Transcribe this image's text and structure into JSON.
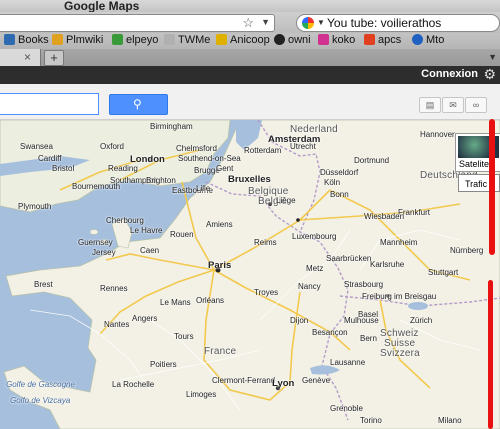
{
  "window": {
    "title": "Google Maps"
  },
  "address_bar": {
    "value": ""
  },
  "search_bar": {
    "value": "You tube: voilierathos"
  },
  "bookmarks": [
    {
      "label": "Books",
      "icon": "book-icon",
      "color": "#2e6ab0"
    },
    {
      "label": "Plmwiki",
      "icon": "wiki-icon",
      "color": "#e0a020"
    },
    {
      "label": "elpeyo",
      "icon": "leaf-icon",
      "color": "#3a9a3a"
    },
    {
      "label": "TWMe",
      "icon": "page-icon",
      "color": "#b0b0b0"
    },
    {
      "label": "Anicoop",
      "icon": "star-icon",
      "color": "#e0b000"
    },
    {
      "label": "owni",
      "icon": "circle-icon",
      "color": "#222222"
    },
    {
      "label": "koko",
      "icon": "flower-icon",
      "color": "#d03090"
    },
    {
      "label": "apcs",
      "icon": "flag-icon",
      "color": "#e04020"
    },
    {
      "label": "Mto",
      "icon": "globe-icon",
      "color": "#2060c0"
    }
  ],
  "tab": {
    "close": "×",
    "new": "+"
  },
  "google_bar": {
    "signin": "Connexion"
  },
  "map_controls": {
    "satellite": "Satelite",
    "traffic": "Trafic"
  },
  "map": {
    "cities": [
      {
        "name": "London",
        "type": "major"
      },
      {
        "name": "Birmingham",
        "type": "major"
      },
      {
        "name": "Cardiff",
        "type": ""
      },
      {
        "name": "Bristol",
        "type": ""
      },
      {
        "name": "Plymouth",
        "type": ""
      },
      {
        "name": "Southampton",
        "type": ""
      },
      {
        "name": "Brighton",
        "type": ""
      },
      {
        "name": "Swansea",
        "type": ""
      },
      {
        "name": "Chelmsford",
        "type": ""
      },
      {
        "name": "Southend-on-Sea",
        "type": ""
      },
      {
        "name": "Oxford",
        "type": ""
      },
      {
        "name": "Reading",
        "type": ""
      },
      {
        "name": "Eastbourne",
        "type": ""
      },
      {
        "name": "Bournemouth",
        "type": ""
      },
      {
        "name": "Guernsey",
        "type": ""
      },
      {
        "name": "Jersey",
        "type": ""
      },
      {
        "name": "Nederland",
        "type": "country"
      },
      {
        "name": "Amsterdam",
        "type": "major"
      },
      {
        "name": "Rotterdam",
        "type": ""
      },
      {
        "name": "Utrecht",
        "type": ""
      },
      {
        "name": "Hannover",
        "type": ""
      },
      {
        "name": "Dortmund",
        "type": ""
      },
      {
        "name": "Düsseldorf",
        "type": ""
      },
      {
        "name": "Köln",
        "type": ""
      },
      {
        "name": "Bonn",
        "type": ""
      },
      {
        "name": "Brugge",
        "type": ""
      },
      {
        "name": "Gent",
        "type": ""
      },
      {
        "name": "Bruxelles",
        "type": "major"
      },
      {
        "name": "Belgique",
        "type": "country"
      },
      {
        "name": "België",
        "type": "country"
      },
      {
        "name": "Lille",
        "type": ""
      },
      {
        "name": "Liège",
        "type": ""
      },
      {
        "name": "Luxembourg",
        "type": ""
      },
      {
        "name": "Frankfurt",
        "type": ""
      },
      {
        "name": "Wiesbaden",
        "type": ""
      },
      {
        "name": "Mannheim",
        "type": ""
      },
      {
        "name": "Saarbrücken",
        "type": ""
      },
      {
        "name": "Karlsruhe",
        "type": ""
      },
      {
        "name": "Stuttgart",
        "type": ""
      },
      {
        "name": "Nürnberg",
        "type": ""
      },
      {
        "name": "Deutschland",
        "type": "country"
      },
      {
        "name": "Strasbourg",
        "type": ""
      },
      {
        "name": "Freiburg im Breisgau",
        "type": ""
      },
      {
        "name": "Basel",
        "type": ""
      },
      {
        "name": "Zürich",
        "type": ""
      },
      {
        "name": "Schweiz",
        "type": "country"
      },
      {
        "name": "Suisse",
        "type": "country"
      },
      {
        "name": "Svizzera",
        "type": "country"
      },
      {
        "name": "Bern",
        "type": ""
      },
      {
        "name": "Genève",
        "type": ""
      },
      {
        "name": "Lausanne",
        "type": ""
      },
      {
        "name": "Paris",
        "type": "major"
      },
      {
        "name": "Reims",
        "type": ""
      },
      {
        "name": "Amiens",
        "type": ""
      },
      {
        "name": "Rouen",
        "type": ""
      },
      {
        "name": "Le Havre",
        "type": ""
      },
      {
        "name": "Caen",
        "type": ""
      },
      {
        "name": "Cherbourg",
        "type": ""
      },
      {
        "name": "Rennes",
        "type": ""
      },
      {
        "name": "Brest",
        "type": ""
      },
      {
        "name": "Le Mans",
        "type": ""
      },
      {
        "name": "Angers",
        "type": ""
      },
      {
        "name": "Nantes",
        "type": ""
      },
      {
        "name": "Tours",
        "type": ""
      },
      {
        "name": "Orléans",
        "type": ""
      },
      {
        "name": "Troyes",
        "type": ""
      },
      {
        "name": "Dijon",
        "type": ""
      },
      {
        "name": "Besançon",
        "type": ""
      },
      {
        "name": "France",
        "type": "country"
      },
      {
        "name": "Poitiers",
        "type": ""
      },
      {
        "name": "Limoges",
        "type": ""
      },
      {
        "name": "Clermont-Ferrand",
        "type": ""
      },
      {
        "name": "Lyon",
        "type": "major"
      },
      {
        "name": "Grenoble",
        "type": ""
      },
      {
        "name": "La Rochelle",
        "type": ""
      },
      {
        "name": "Metz",
        "type": ""
      },
      {
        "name": "Nancy",
        "type": ""
      },
      {
        "name": "Mulhouse",
        "type": ""
      },
      {
        "name": "Golfe de Gascogne",
        "type": "sea"
      },
      {
        "name": "Golfo de Vizcaya",
        "type": "sea"
      },
      {
        "name": "Milano",
        "type": ""
      },
      {
        "name": "Torino",
        "type": ""
      }
    ]
  }
}
